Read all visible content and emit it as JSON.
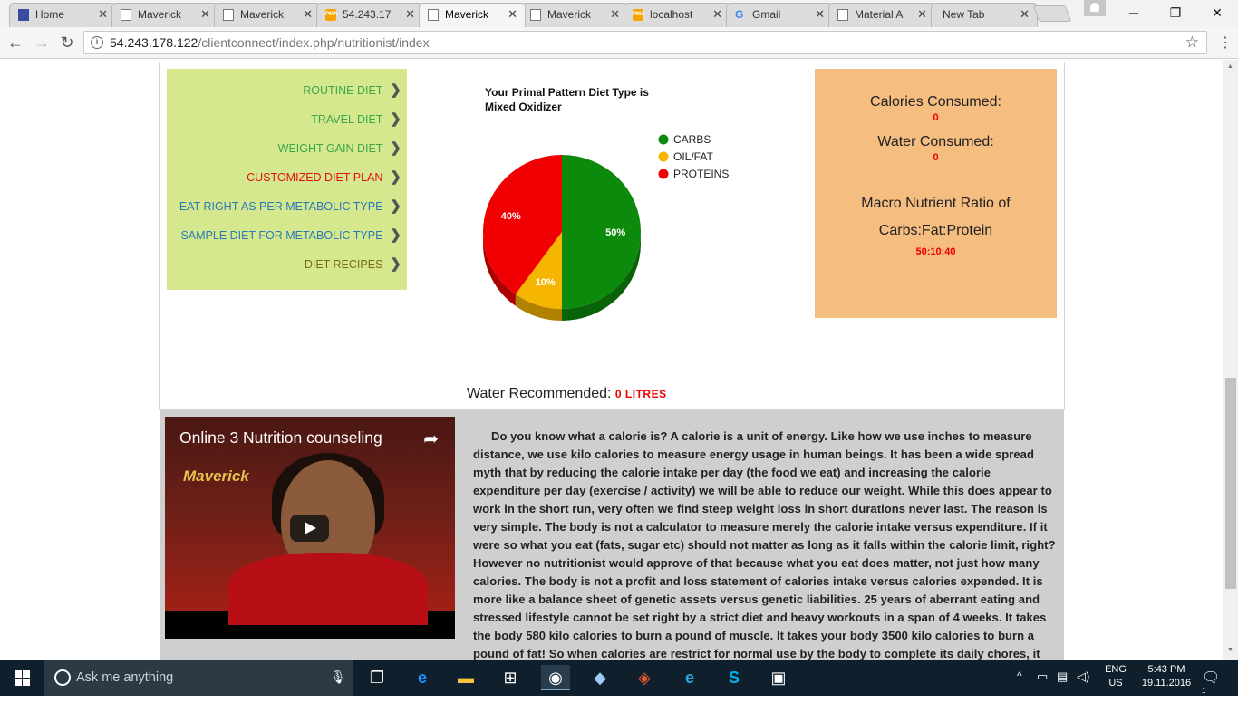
{
  "browser": {
    "tabs": [
      {
        "label": "Home",
        "favicon": "home-icon"
      },
      {
        "label": "Maverick",
        "favicon": "page-icon"
      },
      {
        "label": "Maverick",
        "favicon": "page-icon"
      },
      {
        "label": "54.243.17",
        "favicon": "pma-icon"
      },
      {
        "label": "Maverick",
        "favicon": "page-icon",
        "active": true
      },
      {
        "label": "Maverick",
        "favicon": "page-icon"
      },
      {
        "label": "localhost",
        "favicon": "pma-icon"
      },
      {
        "label": "Gmail",
        "favicon": "gmail-icon"
      },
      {
        "label": "Material A",
        "favicon": "page-icon"
      },
      {
        "label": "New Tab",
        "favicon": "none"
      }
    ],
    "url_host": "54.243.178.122",
    "url_path": "/clientconnect/index.php/nutritionist/index"
  },
  "menu": {
    "items": [
      {
        "label": "ROUTINE DIET",
        "color": "#3aa84a"
      },
      {
        "label": "TRAVEL DIET",
        "color": "#3aa84a"
      },
      {
        "label": "WEIGHT GAIN DIET",
        "color": "#3aa84a"
      },
      {
        "label": "CUSTOMIZED DIET PLAN",
        "color": "#e01010"
      },
      {
        "label": "EAT RIGHT AS PER METABOLIC TYPE",
        "color": "#2a7ab8"
      },
      {
        "label": "SAMPLE DIET FOR METABOLIC TYPE",
        "color": "#2a7ab8"
      },
      {
        "label": "DIET RECIPES",
        "color": "#7a6a12"
      }
    ]
  },
  "chart_data": {
    "type": "pie",
    "title": "Your Primal Pattern Diet Type is Mixed Oxidizer",
    "categories": [
      "CARBS",
      "OIL/FAT",
      "PROTEINS"
    ],
    "values": [
      50,
      10,
      40
    ],
    "labels": [
      "50%",
      "10%",
      "40%"
    ],
    "colors": [
      "#0c8a0c",
      "#f5b400",
      "#f00000"
    ],
    "legend": "right"
  },
  "stats": {
    "calories_label": "Calories Consumed:",
    "calories_value": "0",
    "water_label": "Water Consumed:",
    "water_value": "0",
    "ratio_label_1": "Macro Nutrient Ratio of",
    "ratio_label_2": "Carbs:Fat:Protein",
    "ratio_value": "50:10:40"
  },
  "water_recommended": {
    "label": "Water Recommended:",
    "value": "0 LITRES"
  },
  "video": {
    "title": "Online 3 Nutrition counseling",
    "brand": "Maverick"
  },
  "article": {
    "text": "Do you know what a calorie is? A calorie is a unit of energy. Like how we use inches to measure distance, we use kilo calories to measure energy usage in human beings. It has been a wide spread myth that by reducing the calorie intake per day (the food we eat) and increasing the calorie expenditure per day (exercise / activity) we will be able to reduce our weight. While this does appear to work in the short run, very often we find steep weight loss in short durations never last. The reason is very simple. The body is not a calculator to measure merely the calorie intake versus expenditure. If it were so what you eat (fats, sugar etc) should not matter as long as it falls within the calorie limit, right? However no nutritionist would approve of that because what you eat does matter, not just how many calories. The body is not a profit and loss statement of calories intake versus calories expended. It is more like a balance sheet of genetic assets versus genetic liabilities. 25 years of aberrant eating and stressed lifestyle cannot be set right by a strict diet and heavy workouts in a span of 4 weeks. It takes the body 580 kilo calories to burn a pound of muscle. It takes your body 3500 kilo calories to burn a pound of fat! So when calories are restrict for normal use by the body to complete its daily chores, it would rather"
  },
  "taskbar": {
    "search_placeholder": "Ask me anything",
    "lang_1": "ENG",
    "lang_2": "US",
    "time": "5:43 PM",
    "date": "19.11.2016",
    "notification_count": "1"
  }
}
